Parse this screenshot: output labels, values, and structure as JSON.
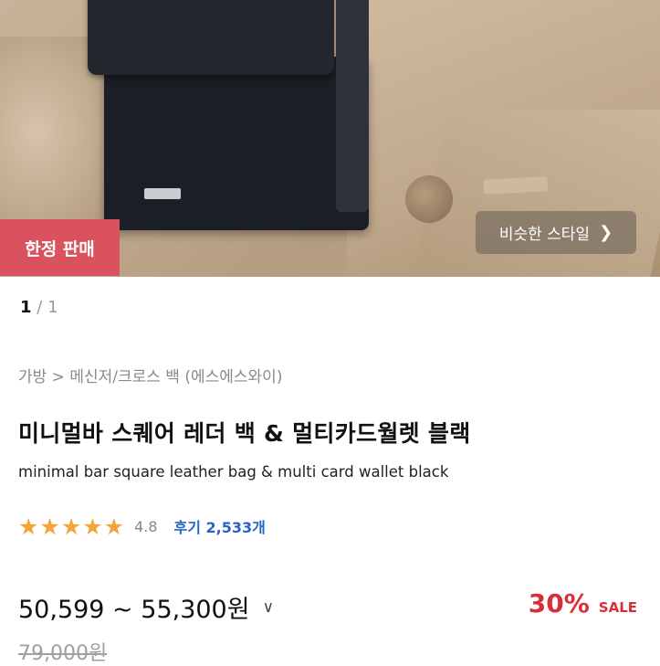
{
  "hero": {
    "badge_label": "한정 판매",
    "similar_style_label": "비슷한 스타일",
    "similar_style_icon": "chevron-right-icon"
  },
  "pager": {
    "current": "1",
    "separator": "/",
    "total": "1"
  },
  "breadcrumb": "가방 > 메신저/크로스 백 (에스에스와이)",
  "product": {
    "title_ko": "미니멀바 스퀘어 레더 백 & 멀티카드월렛 블랙",
    "title_en": "minimal bar square leather bag & multi card wallet black",
    "stars": "★★★★★",
    "rating": "4.8",
    "reviews_label": "후기 2,533개"
  },
  "pricing": {
    "price_range": "50,599 ~ 55,300원",
    "discount_pct": "30%",
    "sale_label": "SALE",
    "original_price": "79,000원"
  },
  "colors": {
    "badge_bg": "#d9525e",
    "star": "#f4a53a",
    "review_link": "#2a62c8",
    "discount": "#d92e3a"
  }
}
